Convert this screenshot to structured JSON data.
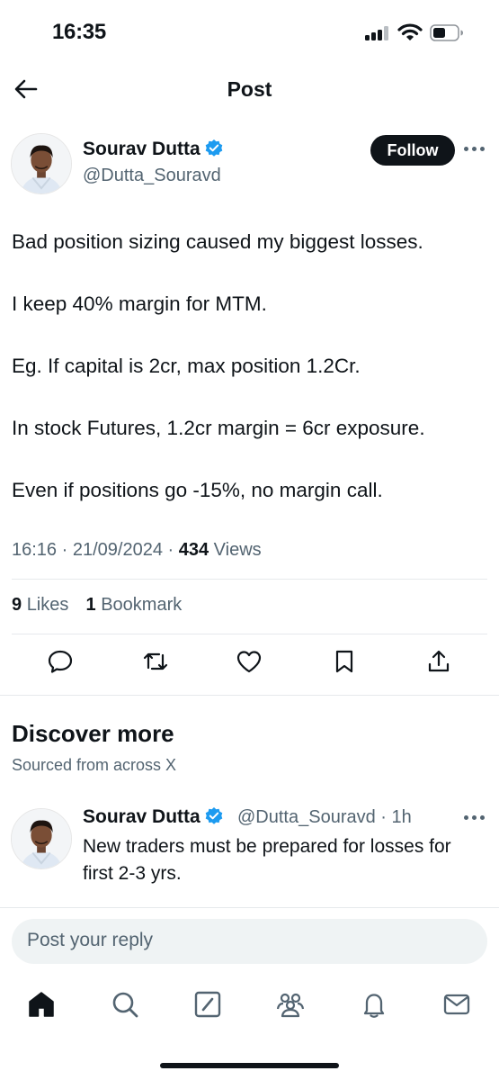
{
  "status_bar": {
    "time": "16:35",
    "icons": [
      "signal-icon",
      "wifi-icon",
      "battery-icon"
    ]
  },
  "header": {
    "title": "Post",
    "back_icon": "back-arrow-icon"
  },
  "post": {
    "author_name": "Sourav Dutta",
    "author_handle": "@Dutta_Souravd",
    "follow_label": "Follow",
    "lines": [
      "Bad position sizing caused my biggest losses.",
      "I keep 40% margin for MTM.",
      "Eg. If capital is 2cr, max position 1.2Cr.",
      "In stock Futures, 1.2cr margin = 6cr exposure.",
      "Even if positions go -15%, no margin call."
    ],
    "time": "16:16",
    "date": "21/09/2024",
    "views_count": "434",
    "views_label": "Views",
    "likes_count": "9",
    "likes_label": "Likes",
    "bookmarks_count": "1",
    "bookmarks_label": "Bookmark",
    "actions": [
      "reply-icon",
      "repost-icon",
      "like-icon",
      "bookmark-icon",
      "share-icon"
    ]
  },
  "discover": {
    "title": "Discover more",
    "subtitle": "Sourced from across X",
    "items": [
      {
        "author_name": "Sourav Dutta",
        "author_handle": "@Dutta_Souravd",
        "age": "1h",
        "text_lines": [
          "New traders must be prepared for losses for",
          "first 2-3 yrs."
        ]
      }
    ]
  },
  "reply": {
    "placeholder": "Post your reply"
  },
  "bottom_nav": [
    "home-icon",
    "search-icon",
    "grok-icon",
    "communities-icon",
    "notifications-icon",
    "messages-icon"
  ],
  "colors": {
    "text_primary": "#0f1419",
    "text_secondary": "#536471",
    "verified_blue": "#1d9bf0",
    "divider": "#e6e9ec",
    "input_bg": "#eff3f4"
  }
}
